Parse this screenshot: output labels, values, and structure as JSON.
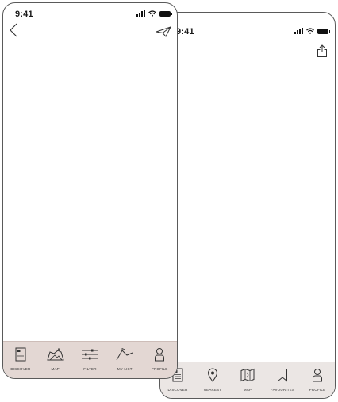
{
  "screen_left": {
    "status": {
      "time": "9:41"
    },
    "header": {
      "back_icon": "chevron-left-icon",
      "send_icon": "paper-plane-icon"
    },
    "tabs": [
      {
        "label": "DISCOVER",
        "icon": "document-icon"
      },
      {
        "label": "MAP",
        "icon": "map-mountain-icon"
      },
      {
        "label": "FILTER",
        "icon": "filter-sliders-icon"
      },
      {
        "label": "MY LIST",
        "icon": "flag-icon"
      },
      {
        "label": "PROFILE",
        "icon": "person-icon"
      }
    ],
    "colors": {
      "tabbar_bg": "#e3d7d3"
    }
  },
  "screen_right": {
    "status": {
      "time": "9:41"
    },
    "header": {
      "share_icon": "share-icon"
    },
    "tabs": [
      {
        "label": "DISCOVER",
        "icon": "document-icon"
      },
      {
        "label": "NEAREST",
        "icon": "location-pin-icon"
      },
      {
        "label": "MAP",
        "icon": "folded-map-icon"
      },
      {
        "label": "FAVOURITES",
        "icon": "bookmark-icon"
      },
      {
        "label": "PROFILE",
        "icon": "person-icon"
      }
    ],
    "colors": {
      "tabbar_bg": "#ebe6e4"
    }
  }
}
